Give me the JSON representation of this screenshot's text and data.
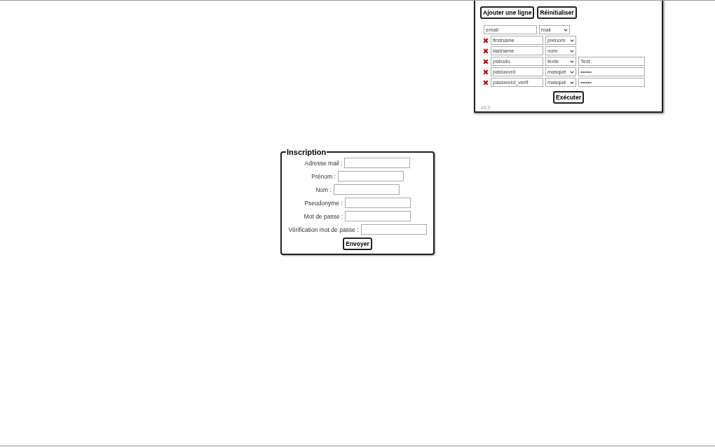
{
  "panel": {
    "buttons": [
      "Ajouter une ligne",
      "Réinitialiser"
    ],
    "rows": [
      {
        "removable": false,
        "name": "email",
        "type": "mail",
        "value": null
      },
      {
        "removable": true,
        "name": "firstname",
        "type": "prénom",
        "value": null
      },
      {
        "removable": true,
        "name": "lastname",
        "type": "nom",
        "value": null
      },
      {
        "removable": true,
        "name": "pseudo",
        "type": "texte",
        "value": "Test"
      },
      {
        "removable": true,
        "name": "password",
        "type": "masqué",
        "value": "••••••"
      },
      {
        "removable": true,
        "name": "password_verif",
        "type": "masqué",
        "value": "••••••"
      }
    ],
    "execute_button": "Exécuter",
    "version": "v0.3"
  },
  "form": {
    "legend": "Inscription",
    "fields": [
      {
        "label": "Adresse mail :"
      },
      {
        "label": "Prénom :"
      },
      {
        "label": "Nom :"
      },
      {
        "label": "Pseudonyme :"
      },
      {
        "label": "Mot de passe :"
      },
      {
        "label": "Vérification mot de passe :"
      }
    ],
    "submit": "Envoyer"
  }
}
